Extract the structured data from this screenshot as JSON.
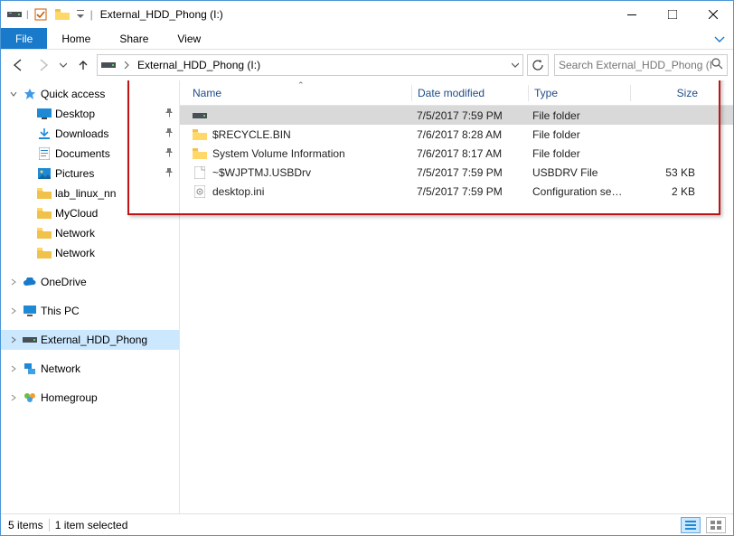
{
  "title": {
    "app": "External_HDD_Phong (I:)"
  },
  "ribbon": {
    "file": "File",
    "home": "Home",
    "share": "Share",
    "view": "View"
  },
  "address": {
    "location": "External_HDD_Phong (I:)"
  },
  "search": {
    "placeholder": "Search External_HDD_Phong (I:)"
  },
  "columns": {
    "name": "Name",
    "date": "Date modified",
    "type": "Type",
    "size": "Size"
  },
  "tree": {
    "quick_access": "Quick access",
    "desktop": "Desktop",
    "downloads": "Downloads",
    "documents": "Documents",
    "pictures": "Pictures",
    "lab_linux": "lab_linux_nn",
    "mycloud": "MyCloud",
    "network1": "Network",
    "network2": "Network",
    "onedrive": "OneDrive",
    "this_pc": "This PC",
    "ext_hdd": "External_HDD_Phong",
    "network": "Network",
    "homegroup": "Homegroup"
  },
  "rows": [
    {
      "name": "",
      "date": "7/5/2017 7:59 PM",
      "type": "File folder",
      "size": "",
      "icon": "drive",
      "selected": true
    },
    {
      "name": "$RECYCLE.BIN",
      "date": "7/6/2017 8:28 AM",
      "type": "File folder",
      "size": "",
      "icon": "folder"
    },
    {
      "name": "System Volume Information",
      "date": "7/6/2017 8:17 AM",
      "type": "File folder",
      "size": "",
      "icon": "folder"
    },
    {
      "name": "~$WJPTMJ.USBDrv",
      "date": "7/5/2017 7:59 PM",
      "type": "USBDRV File",
      "size": "53 KB",
      "icon": "file"
    },
    {
      "name": "desktop.ini",
      "date": "7/5/2017 7:59 PM",
      "type": "Configuration sett...",
      "size": "2 KB",
      "icon": "ini"
    }
  ],
  "status": {
    "count": "5 items",
    "selected": "1 item selected"
  }
}
